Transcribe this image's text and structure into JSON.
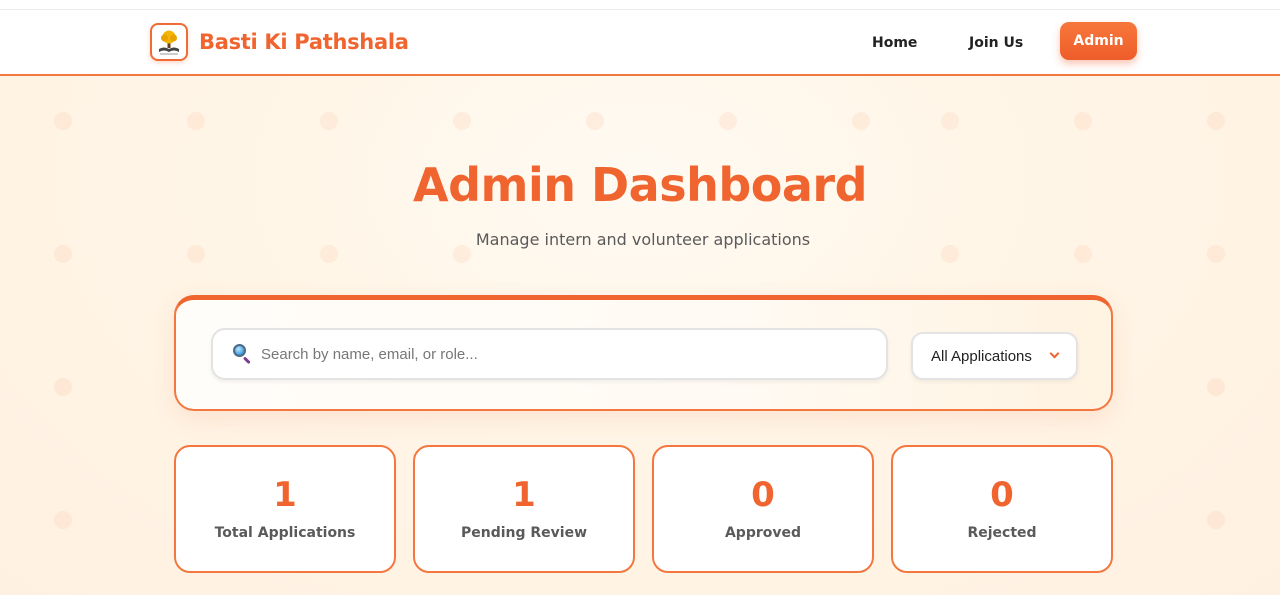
{
  "brand": {
    "name": "Basti Ki Pathshala",
    "logo_icon": "tree-book-logo-icon"
  },
  "nav": {
    "home": "Home",
    "join_us": "Join Us",
    "admin": "Admin"
  },
  "page": {
    "title": "Admin Dashboard",
    "subtitle": "Manage intern and volunteer applications"
  },
  "filters": {
    "search_placeholder": "Search by name, email, or role...",
    "search_value": "",
    "status_selected": "All Applications"
  },
  "stats": [
    {
      "value": "1",
      "label": "Total Applications"
    },
    {
      "value": "1",
      "label": "Pending Review"
    },
    {
      "value": "0",
      "label": "Approved"
    },
    {
      "value": "0",
      "label": "Rejected"
    }
  ],
  "colors": {
    "accent": "#f0652f",
    "background": "#fff7ec"
  }
}
